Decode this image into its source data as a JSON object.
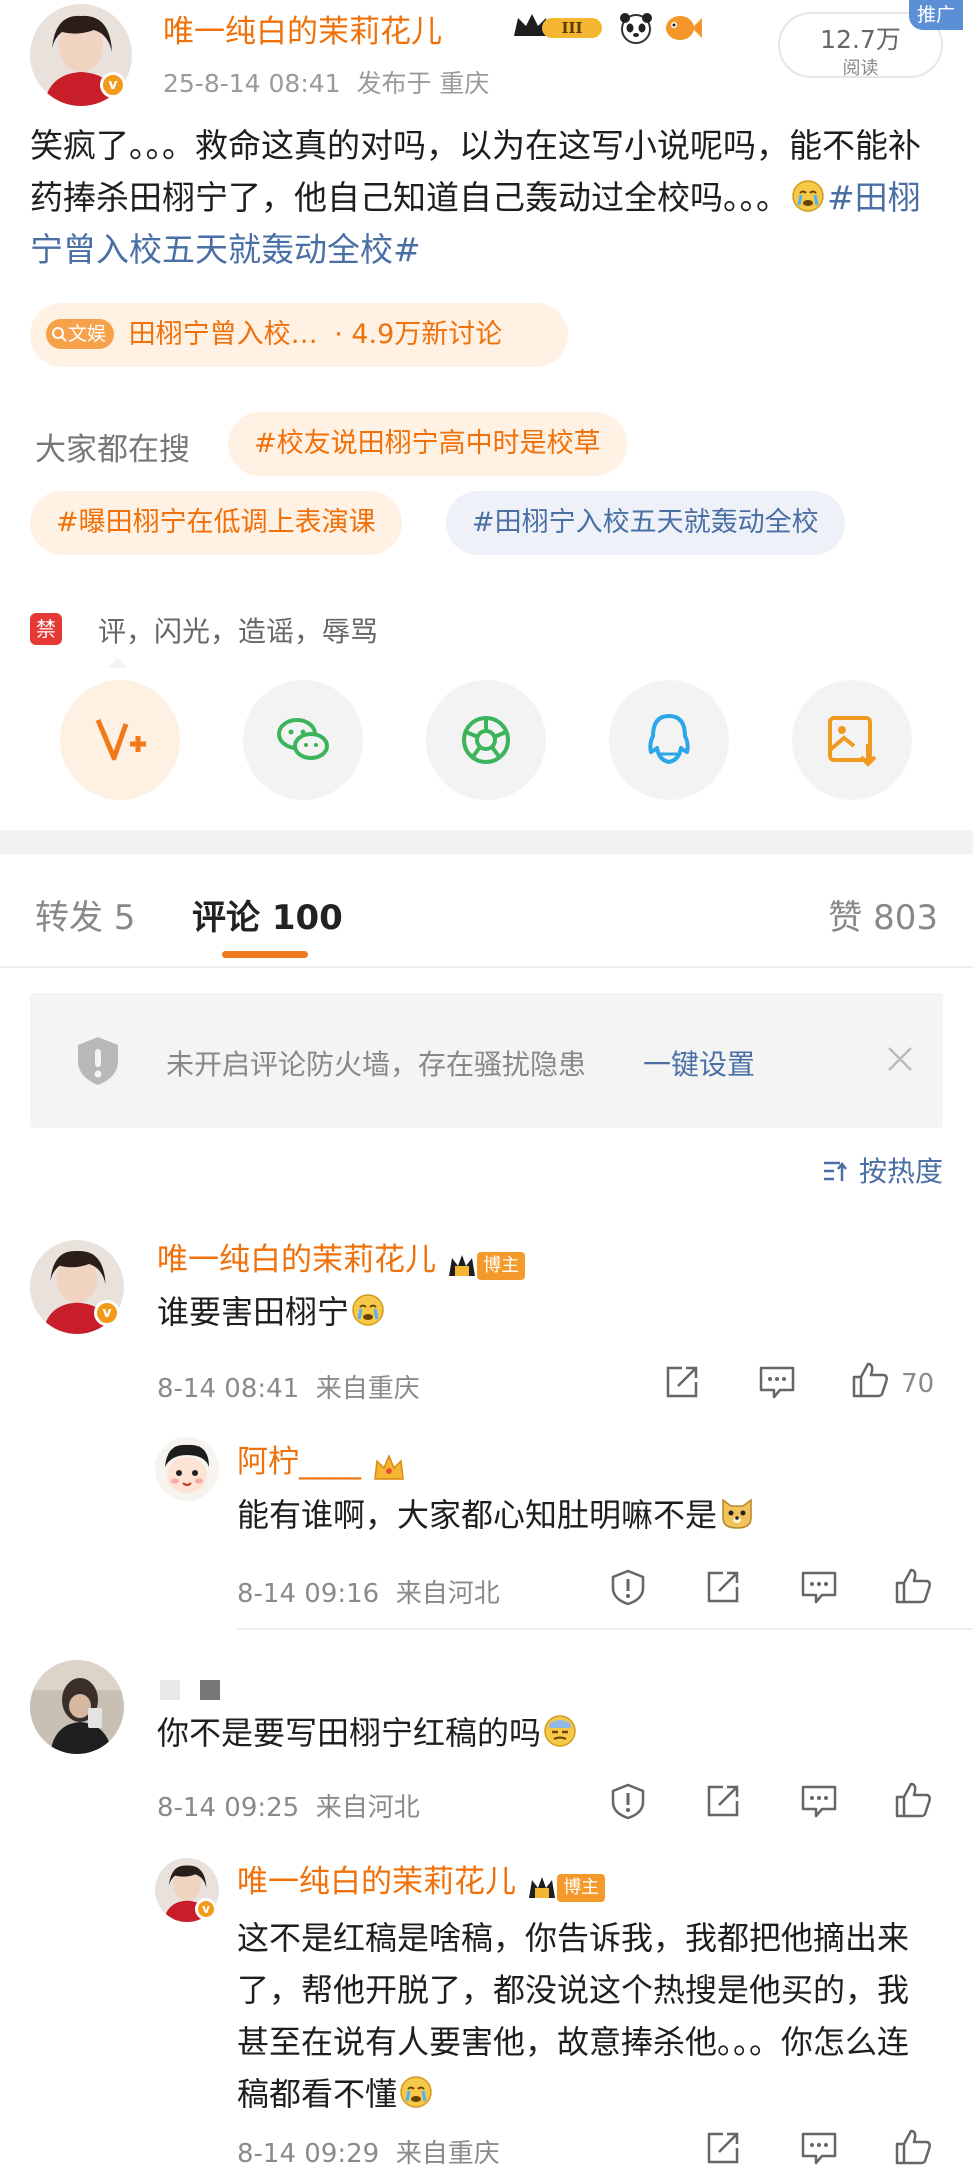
{
  "post": {
    "author": "唯一纯白的茉莉花儿",
    "time": "25-8-14 08:41",
    "published_in": "发布于 重庆",
    "reads": "12.7万",
    "reads_label": "阅读",
    "promo_badge": "推广",
    "text": "笑疯了。。。救命这真的对吗，以为在这写小说呢吗，能不能补药捧杀田栩宁了，他自己知道自己轰动过全校吗。。。",
    "text_topic": "#田栩宁曾入校五天就轰动全校#",
    "wenyu_tag": "文娱",
    "topic_pill": "田栩宁曾入校…",
    "topic_pill_stats": "· 4.9万新讨论",
    "search_label": "大家都在搜",
    "search_tags": [
      "#校友说田栩宁高中时是校草",
      "#曝田栩宁在低调上表演课",
      "#田栩宁入校五天就轰动全校"
    ],
    "ban_badge": "禁",
    "ban_text": "评，闪光，造谣，辱骂"
  },
  "tabs": {
    "repost": "转发 5",
    "comments": "评论 100",
    "likes": "赞 803"
  },
  "notice": {
    "text": "未开启评论防火墙，存在骚扰隐患",
    "link": "一键设置"
  },
  "sort_label": "按热度",
  "comments": [
    {
      "name": "唯一纯白的茉莉花儿",
      "tag": "博主",
      "text": "谁要害田栩宁",
      "time": "8-14 08:41",
      "location": "来自重庆",
      "likes": "70"
    },
    {
      "name": "阿柠____",
      "text": "能有谁啊，大家都心知肚明嘛不是",
      "time": "8-14 09:16",
      "location": "来自河北"
    },
    {
      "name": "",
      "text": "你不是要写田栩宁红稿的吗",
      "time": "8-14 09:25",
      "location": "来自河北"
    },
    {
      "name": "唯一纯白的茉莉花儿",
      "tag": "博主",
      "text": "这不是红稿是啥稿，你告诉我，我都把他摘出来了，帮他开脱了，都没说这个热搜是他买的，我甚至在说有人要害他，故意捧杀他。。。你怎么连稿都看不懂",
      "time": "8-14 09:29",
      "location": "来自重庆"
    }
  ],
  "colors": {
    "orange": "#f0700a",
    "topic_blue": "#4a6fa5",
    "meta_gray": "#8a8a8a"
  }
}
